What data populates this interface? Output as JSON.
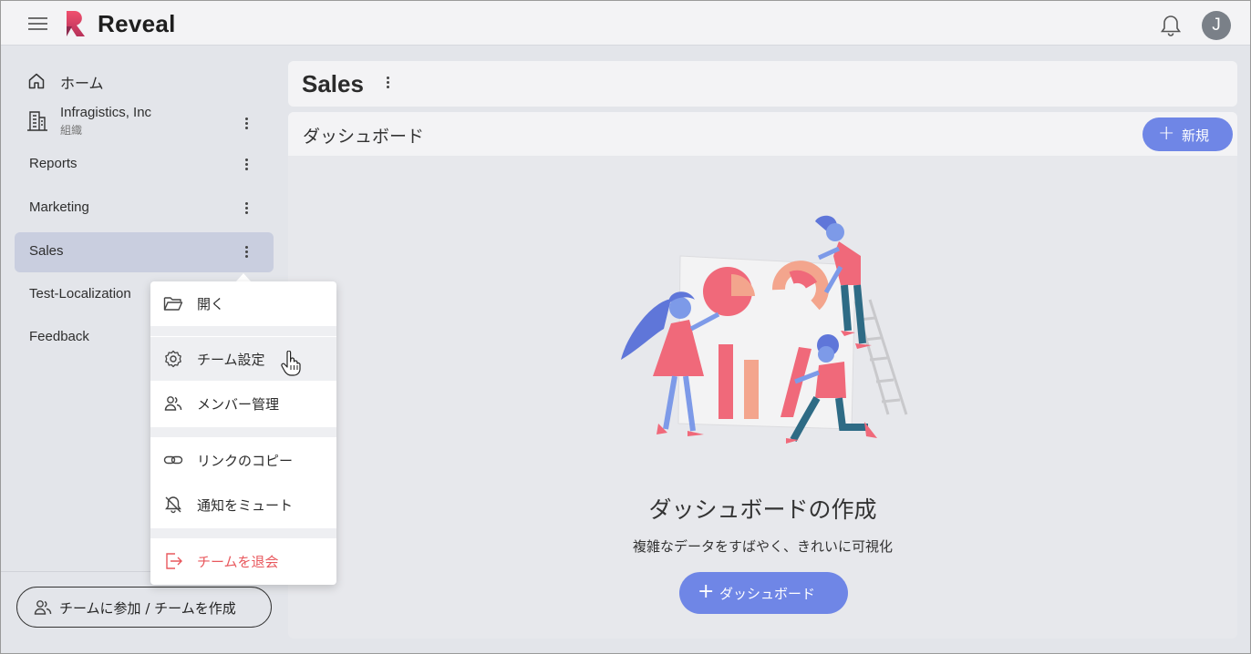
{
  "app": {
    "brand": "Reveal",
    "user_initial": "J",
    "accent_color": "#6f86e6",
    "danger_color": "#e8585d"
  },
  "sidebar": {
    "home_label": "ホーム",
    "org_name": "Infragistics, Inc",
    "org_type": "組織",
    "items": [
      {
        "label": "Reports"
      },
      {
        "label": "Marketing"
      },
      {
        "label": "Sales",
        "active": true
      },
      {
        "label": "Test-Localization"
      },
      {
        "label": "Feedback"
      }
    ],
    "join_button_label": "チームに参加 / チームを作成"
  },
  "main": {
    "page_title": "Sales",
    "section_label": "ダッシュボード",
    "new_button_label": "新規",
    "empty_title": "ダッシュボードの作成",
    "empty_subtitle": "複雑なデータをすばやく、きれいに可視化",
    "create_button_label": "ダッシュボード"
  },
  "context_menu": {
    "items": [
      {
        "label": "開く",
        "icon": "folder-icon"
      },
      {
        "label": "チーム設定",
        "icon": "gear-icon",
        "hovered": true
      },
      {
        "label": "メンバー管理",
        "icon": "members-icon"
      },
      {
        "label": "リンクのコピー",
        "icon": "link-icon"
      },
      {
        "label": "通知をミュート",
        "icon": "bell-off-icon"
      },
      {
        "label": "チームを退会",
        "icon": "exit-icon",
        "danger": true
      }
    ]
  }
}
